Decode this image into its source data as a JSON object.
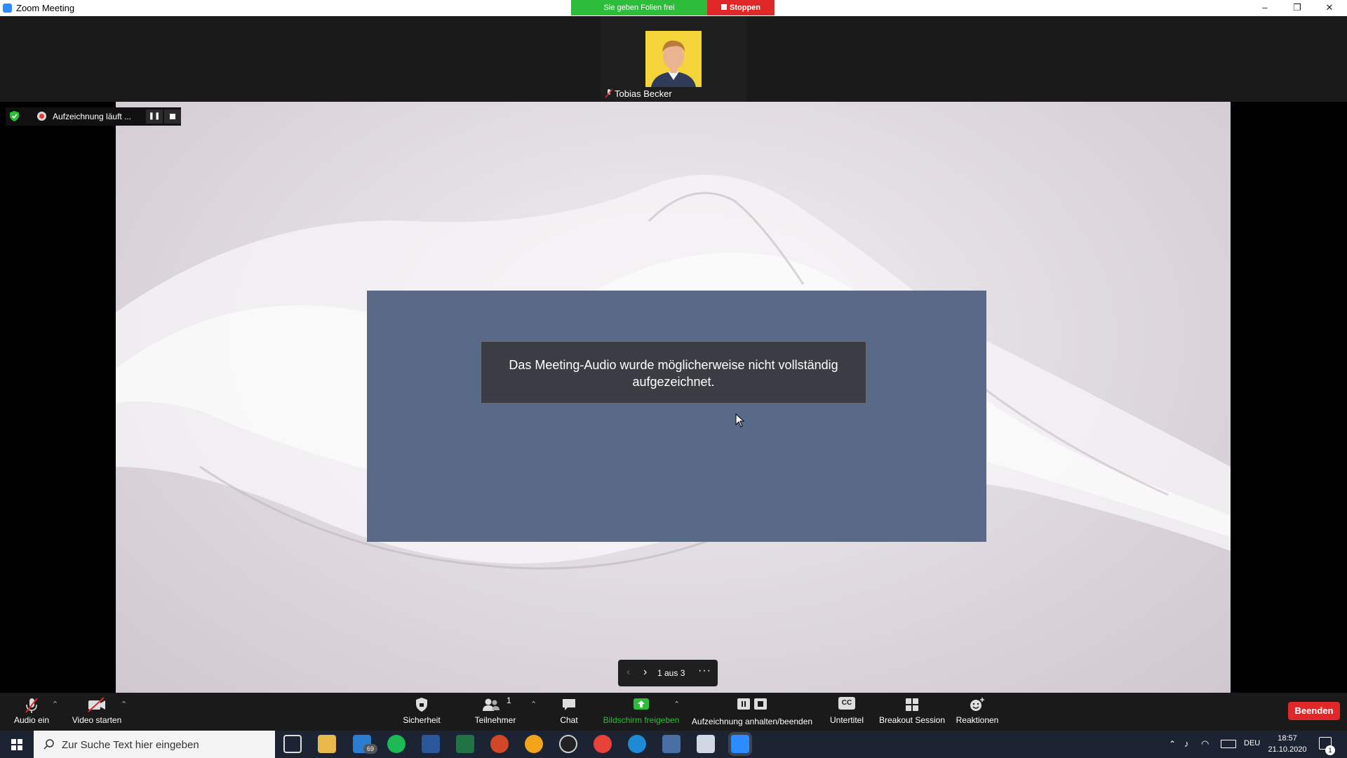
{
  "window": {
    "title": "Zoom Meeting",
    "minimize": "–",
    "restore": "❐",
    "close": "✕"
  },
  "share_bar": {
    "status_label": "Sie geben Folien frei",
    "stop_label": "Stoppen"
  },
  "participant": {
    "name": "Tobias Becker"
  },
  "recording": {
    "status_label": "Aufzeichnung läuft ...",
    "pause_glyph": "❚❚"
  },
  "notification": {
    "message": "Das Meeting-Audio wurde möglicherweise nicht vollständig aufgezeichnet."
  },
  "slide_nav": {
    "prev_glyph": "‹",
    "next_glyph": "›",
    "counter": "1 aus 3",
    "more_glyph": "···"
  },
  "toolbar": {
    "audio_label": "Audio ein",
    "video_label": "Video starten",
    "security_label": "Sicherheit",
    "participants_label": "Teilnehmer",
    "participants_count": "1",
    "chat_label": "Chat",
    "share_label": "Bildschirm freigeben",
    "recording_label": "Aufzeichnung anhalten/beenden",
    "captions_label": "Untertitel",
    "captions_glyph": "CC",
    "breakout_label": "Breakout Session",
    "reactions_label": "Reaktionen",
    "end_label": "Beenden",
    "share_accent": "#2ebd3b"
  },
  "taskbar": {
    "search_placeholder": "Zur Suche Text hier eingeben",
    "mail_badge": "69",
    "language": "DEU",
    "time": "18:57",
    "date": "21.10.2020",
    "notification_count": "1"
  }
}
